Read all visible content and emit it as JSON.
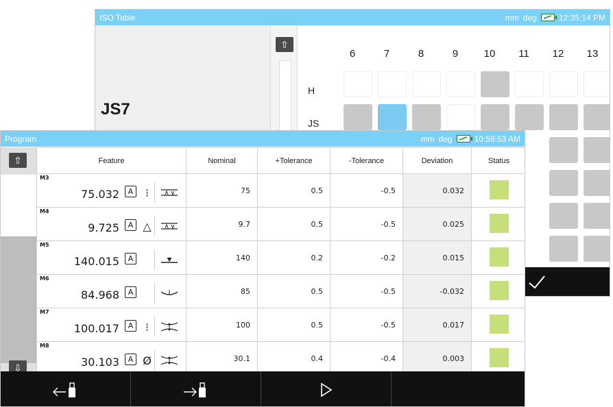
{
  "iso_window": {
    "title": "ISO Table",
    "units": "mm",
    "angle_units": "deg",
    "time": "12:35:14 PM",
    "selected": "JS7",
    "columns": [
      "6",
      "7",
      "8",
      "9",
      "10",
      "11",
      "12",
      "13"
    ],
    "rows": [
      "H",
      "JS"
    ],
    "confirm_icon": "checkmark-icon"
  },
  "program_window": {
    "title": "Program",
    "units": "mm",
    "angle_units": "deg",
    "time": "10:59:53 AM",
    "headers": {
      "feature": "Feature",
      "nominal": "Nominal",
      "plus_tol": "+Tolerance",
      "minus_tol": "-Tolerance",
      "deviation": "Deviation",
      "status": "Status"
    },
    "rows": [
      {
        "id": "M3",
        "value": "75.032",
        "datum": "A",
        "sym": "⁝",
        "nominal": "75",
        "plus": "0.5",
        "minus": "-0.5",
        "deviation": "0.032"
      },
      {
        "id": "M4",
        "value": "9.725",
        "datum": "A",
        "sym": "△",
        "nominal": "9.7",
        "plus": "0.5",
        "minus": "-0.5",
        "deviation": "0.025"
      },
      {
        "id": "M5",
        "value": "140.015",
        "datum": "A",
        "sym": "",
        "nominal": "140",
        "plus": "0.2",
        "minus": "-0.2",
        "deviation": "0.015"
      },
      {
        "id": "M6",
        "value": "84.968",
        "datum": "A",
        "sym": "",
        "nominal": "85",
        "plus": "0.5",
        "minus": "-0.5",
        "deviation": "-0.032"
      },
      {
        "id": "M7",
        "value": "100.017",
        "datum": "A",
        "sym": "⁝",
        "nominal": "100",
        "plus": "0.5",
        "minus": "-0.5",
        "deviation": "0.017"
      },
      {
        "id": "M8",
        "value": "30.103",
        "datum": "A",
        "sym": "Ø",
        "nominal": "30.1",
        "plus": "0.4",
        "minus": "-0.4",
        "deviation": "0.003"
      }
    ],
    "status_color": "#c6df7a"
  },
  "colors": {
    "titlebar": "#7bd0f5",
    "selected_cell": "#7bcaf2",
    "gray_cell": "#c8c8c8",
    "white_cell": "#ffffff"
  }
}
